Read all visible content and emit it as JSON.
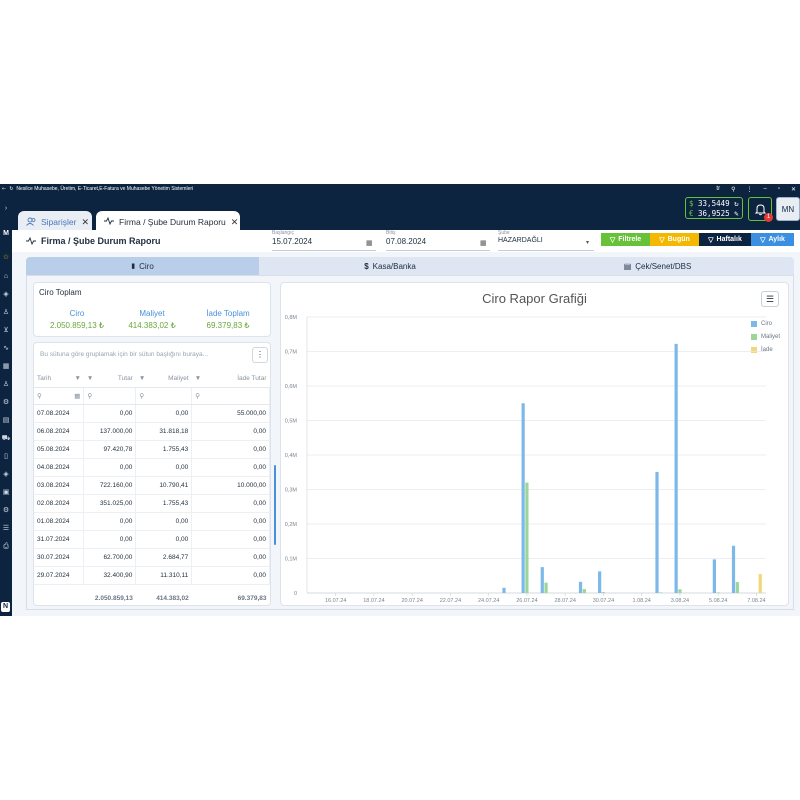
{
  "window": {
    "title": "Nesilce Muhasebe, Üretim, E-Ticaret,E-Fatura ve Muhasebe Yönetim Sistemleri"
  },
  "tabs": [
    {
      "label": "Siparişler",
      "active": false
    },
    {
      "label": "Firma / Şube Durum Raporu",
      "active": true
    }
  ],
  "rates": {
    "usd_symbol": "$",
    "usd": "33,5449",
    "eur_symbol": "€",
    "eur": "36,9525"
  },
  "notifications": {
    "count": "1"
  },
  "user": {
    "initials": "MN"
  },
  "sidebar": {
    "logo": "M",
    "bottom": "N"
  },
  "header": {
    "title": "Firma / Şube Durum Raporu",
    "start": {
      "label": "Başlangıç",
      "value": "15.07.2024"
    },
    "end": {
      "label": "Bitiş",
      "value": "07.08.2024"
    },
    "branch": {
      "label": "Şube",
      "value": "HAZARDAĞLI"
    },
    "buttons": {
      "filter": "Filtrele",
      "today": "Bugün",
      "weekly": "Haftalık",
      "monthly": "Aylık"
    }
  },
  "main_tabs": [
    "Ciro",
    "Kasa/Banka",
    "Çek/Senet/DBS"
  ],
  "summary": {
    "title": "Ciro Toplam",
    "ciro_label": "Ciro",
    "ciro": "2.050.859,13 ₺",
    "maliyet_label": "Maliyet",
    "maliyet": "414.383,02 ₺",
    "iade_label": "İade Toplam",
    "iade": "69.379,83 ₺"
  },
  "grid": {
    "group_hint": "Bu sütuna göre gruplamak için bir sütun başlığını buraya...",
    "columns": [
      "Tarih",
      "Tutar",
      "Maliyet",
      "İade Tutar"
    ],
    "rows": [
      [
        "07.08.2024",
        "0,00",
        "0,00",
        "55.000,00"
      ],
      [
        "06.08.2024",
        "137.000,00",
        "31.818,18",
        "0,00"
      ],
      [
        "05.08.2024",
        "97.420,78",
        "1.755,43",
        "0,00"
      ],
      [
        "04.08.2024",
        "0,00",
        "0,00",
        "0,00"
      ],
      [
        "03.08.2024",
        "722.160,00",
        "10.790,41",
        "10.000,00"
      ],
      [
        "02.08.2024",
        "351.025,00",
        "1.755,43",
        "0,00"
      ],
      [
        "01.08.2024",
        "0,00",
        "0,00",
        "0,00"
      ],
      [
        "31.07.2024",
        "0,00",
        "0,00",
        "0,00"
      ],
      [
        "30.07.2024",
        "62.700,00",
        "2.684,77",
        "0,00"
      ],
      [
        "29.07.2024",
        "32.400,90",
        "11.310,11",
        "0,00"
      ]
    ],
    "totals": [
      "",
      "2.050.859,13",
      "414.383,02",
      "69.379,83"
    ]
  },
  "chart_data": {
    "type": "bar",
    "title": "Ciro Rapor Grafiği",
    "x": [
      "15.07.24",
      "16.07.24",
      "17.07.24",
      "18.07.24",
      "19.07.24",
      "20.07.24",
      "21.07.24",
      "22.07.24",
      "23.07.24",
      "24.07.24",
      "25.07.24",
      "26.07.24",
      "27.07.24",
      "28.07.24",
      "29.07.24",
      "30.07.24",
      "31.07.24",
      "1.08.24",
      "2.08.24",
      "3.08.24",
      "4.08.24",
      "5.08.24",
      "6.08.24",
      "7.08.24"
    ],
    "tick_labels": [
      "16.07.24",
      "18.07.24",
      "20.07.24",
      "22.07.24",
      "24.07.24",
      "26.07.24",
      "28.07.24",
      "30.07.24",
      "1.08.24",
      "3.08.24",
      "5.08.24",
      "7.08.24"
    ],
    "series": [
      {
        "name": "Ciro",
        "color": "#7db8e8",
        "values": [
          0,
          0,
          0,
          0,
          0,
          0,
          0,
          0,
          0,
          0,
          15000,
          550000,
          75000,
          0,
          32400.9,
          62700,
          0,
          0,
          351025,
          722160,
          0,
          97420.78,
          137000,
          0
        ]
      },
      {
        "name": "Maliyet",
        "color": "#9ad69a",
        "values": [
          0,
          0,
          0,
          0,
          0,
          0,
          0,
          0,
          0,
          0,
          0,
          320000,
          30000,
          0,
          11310.11,
          2684.77,
          0,
          0,
          1755.43,
          10790.41,
          0,
          1755.43,
          31818.18,
          0
        ]
      },
      {
        "name": "İade",
        "color": "#f0d77a",
        "values": [
          0,
          0,
          0,
          0,
          0,
          0,
          0,
          0,
          0,
          0,
          0,
          0,
          0,
          0,
          0,
          0,
          0,
          0,
          0,
          0,
          0,
          0,
          0,
          55000
        ]
      }
    ],
    "yticks": [
      "0",
      "0,1M",
      "0,2M",
      "0,3M",
      "0,4M",
      "0,5M",
      "0,6M",
      "0,7M",
      "0,8M"
    ],
    "ylim": [
      0,
      800000
    ]
  }
}
